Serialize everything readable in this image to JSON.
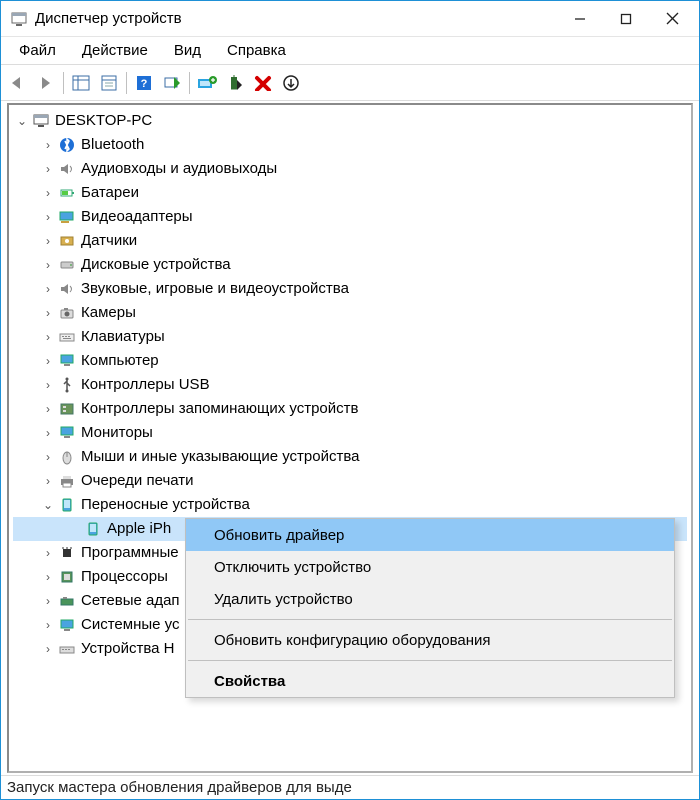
{
  "window": {
    "title": "Диспетчер устройств"
  },
  "menubar": {
    "file": "Файл",
    "action": "Действие",
    "view": "Вид",
    "help": "Справка"
  },
  "tree": {
    "root": "DESKTOP-PC",
    "items": [
      {
        "label": "Bluetooth",
        "icon": "bluetooth"
      },
      {
        "label": "Аудиовходы и аудиовыходы",
        "icon": "speaker"
      },
      {
        "label": "Батареи",
        "icon": "battery"
      },
      {
        "label": "Видеоадаптеры",
        "icon": "display"
      },
      {
        "label": "Датчики",
        "icon": "sensor"
      },
      {
        "label": "Дисковые устройства",
        "icon": "disk"
      },
      {
        "label": "Звуковые, игровые и видеоустройства",
        "icon": "speaker"
      },
      {
        "label": "Камеры",
        "icon": "camera"
      },
      {
        "label": "Клавиатуры",
        "icon": "keyboard"
      },
      {
        "label": "Компьютер",
        "icon": "monitor"
      },
      {
        "label": "Контроллеры USB",
        "icon": "usb"
      },
      {
        "label": "Контроллеры запоминающих устройств",
        "icon": "storage-ctrl"
      },
      {
        "label": "Мониторы",
        "icon": "monitor2"
      },
      {
        "label": "Мыши и иные указывающие устройства",
        "icon": "mouse"
      },
      {
        "label": "Очереди печати",
        "icon": "printer"
      },
      {
        "label": "Переносные устройства",
        "icon": "portable",
        "expanded": true,
        "children": [
          {
            "label": "Apple iPhone",
            "icon": "portable",
            "selected": true
          }
        ]
      },
      {
        "label": "Программные устройства",
        "icon": "chip",
        "truncated": "Программные"
      },
      {
        "label": "Процессоры",
        "icon": "cpu"
      },
      {
        "label": "Сетевые адаптеры",
        "icon": "net",
        "truncated": "Сетевые адап"
      },
      {
        "label": "Системные устройства",
        "icon": "sys",
        "truncated": "Системные ус"
      },
      {
        "label": "Устройства HID (Human Interface Devices)",
        "icon": "hid",
        "truncated": "Устройства H"
      }
    ]
  },
  "context_menu": {
    "update_driver": "Обновить драйвер",
    "disable_device": "Отключить устройство",
    "uninstall_device": "Удалить устройство",
    "scan_hardware": "Обновить конфигурацию оборудования",
    "properties": "Свойства"
  },
  "statusbar": "Запуск мастера обновления драйверов для выде"
}
